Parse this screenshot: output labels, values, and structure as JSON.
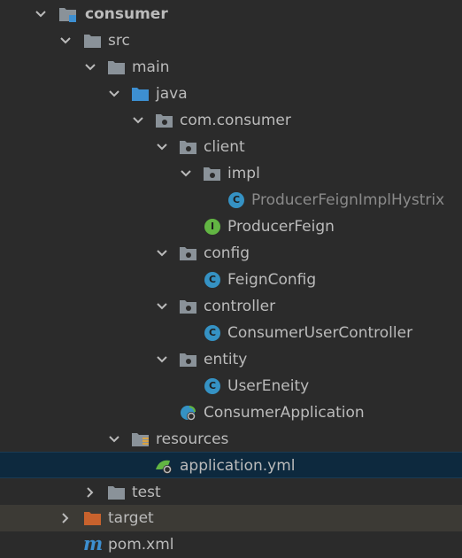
{
  "tree": {
    "items": [
      {
        "label": "consumer",
        "icon": "module-folder-icon"
      },
      {
        "label": "src",
        "icon": "folder-icon"
      },
      {
        "label": "main",
        "icon": "folder-icon"
      },
      {
        "label": "java",
        "icon": "source-folder-icon"
      },
      {
        "label": "com.consumer",
        "icon": "package-icon"
      },
      {
        "label": "client",
        "icon": "package-icon"
      },
      {
        "label": "impl",
        "icon": "package-icon"
      },
      {
        "label": "ProducerFeignImplHystrix",
        "icon": "class-icon",
        "badge": "C"
      },
      {
        "label": "ProducerFeign",
        "icon": "interface-icon",
        "badge": "I"
      },
      {
        "label": "config",
        "icon": "package-icon"
      },
      {
        "label": "FeignConfig",
        "icon": "class-icon",
        "badge": "C"
      },
      {
        "label": "controller",
        "icon": "package-icon"
      },
      {
        "label": "ConsumerUserController",
        "icon": "class-icon",
        "badge": "C"
      },
      {
        "label": "entity",
        "icon": "package-icon"
      },
      {
        "label": "UserEneity",
        "icon": "class-icon",
        "badge": "C"
      },
      {
        "label": "ConsumerApplication",
        "icon": "spring-boot-app-icon"
      },
      {
        "label": "resources",
        "icon": "resources-folder-icon"
      },
      {
        "label": "application.yml",
        "icon": "spring-yaml-icon"
      },
      {
        "label": "test",
        "icon": "folder-icon"
      },
      {
        "label": "target",
        "icon": "excluded-folder-icon"
      },
      {
        "label": "pom.xml",
        "icon": "maven-icon",
        "badge": "m"
      }
    ]
  },
  "colors": {
    "background": "#2b2b2b",
    "selection": "#0d293e",
    "excluded_row": "#3c3a35",
    "class_badge": "#3592c4",
    "interface_badge": "#62b543",
    "source_folder": "#3d8fd1",
    "excluded_folder": "#c8622d",
    "folder": "#8a9299"
  }
}
